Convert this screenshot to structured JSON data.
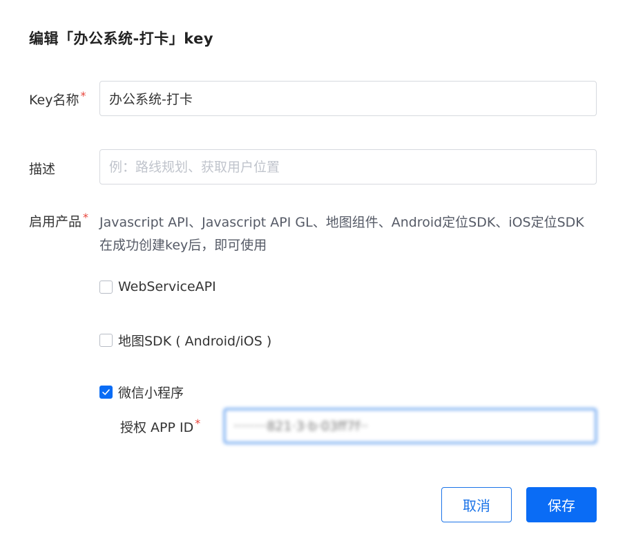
{
  "dialog": {
    "title": "编辑「办公系统-打卡」key"
  },
  "form": {
    "key_name": {
      "label": "Key名称",
      "required_mark": "*",
      "value": "办公系统-打卡"
    },
    "description": {
      "label": "描述",
      "placeholder": "例：路线规划、获取用户位置",
      "value": ""
    },
    "products": {
      "label": "启用产品",
      "required_mark": "*",
      "note": "Javascript API、Javascript API GL、地图组件、Android定位SDK、iOS定位SDK在成功创建key后，即可使用",
      "options": [
        {
          "label": "WebServiceAPI",
          "checked": false
        },
        {
          "label": "地图SDK ( Android/iOS )",
          "checked": false
        },
        {
          "label": "微信小程序",
          "checked": true
        }
      ]
    },
    "appid": {
      "label": "授权 APP ID",
      "required_mark": "*",
      "value": "········821·3·b·03ff7f··"
    }
  },
  "buttons": {
    "cancel": "取消",
    "save": "保存"
  },
  "colors": {
    "accent": "#0a6cf5",
    "required": "#e8453c",
    "border": "#d6d9de"
  }
}
